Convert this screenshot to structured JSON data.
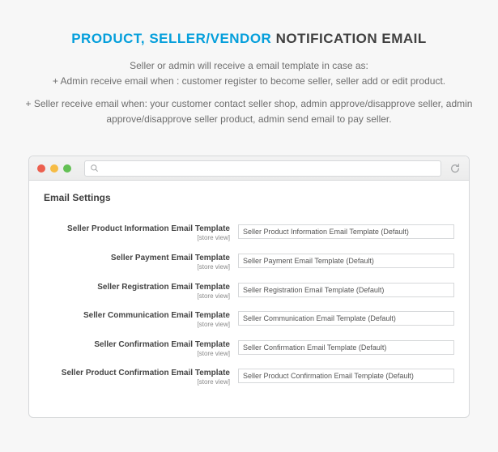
{
  "heading": {
    "part1": "PRODUCT, SELLER/VENDOR",
    "part2": " NOTIFICATION EMAIL"
  },
  "desc": {
    "line1": "Seller or admin will receive a email template in case as:",
    "line2": "+ Admin receive email when : customer register to become seller, seller add or edit product.",
    "line3": "+ Seller receive email when: your customer contact seller shop, admin approve/disapprove seller, admin approve/disapprove seller product, admin send email to pay seller."
  },
  "panel": {
    "title": "Email Settings",
    "scope": "[store view]",
    "rows": [
      {
        "label": "Seller Product Information Email Template",
        "value": "Seller Product Information Email Template (Default)"
      },
      {
        "label": "Seller Payment Email Template",
        "value": "Seller Payment Email Template (Default)"
      },
      {
        "label": "Seller Registration Email Template",
        "value": "Seller Registration Email Template (Default)"
      },
      {
        "label": "Seller Communication Email Template",
        "value": "Seller Communication Email Template (Default)"
      },
      {
        "label": "Seller Confirmation Email Template",
        "value": "Seller Confirmation Email Template (Default)"
      },
      {
        "label": "Seller Product Confirmation Email Template",
        "value": "Seller Product Confirmation Email Template (Default)"
      }
    ]
  }
}
